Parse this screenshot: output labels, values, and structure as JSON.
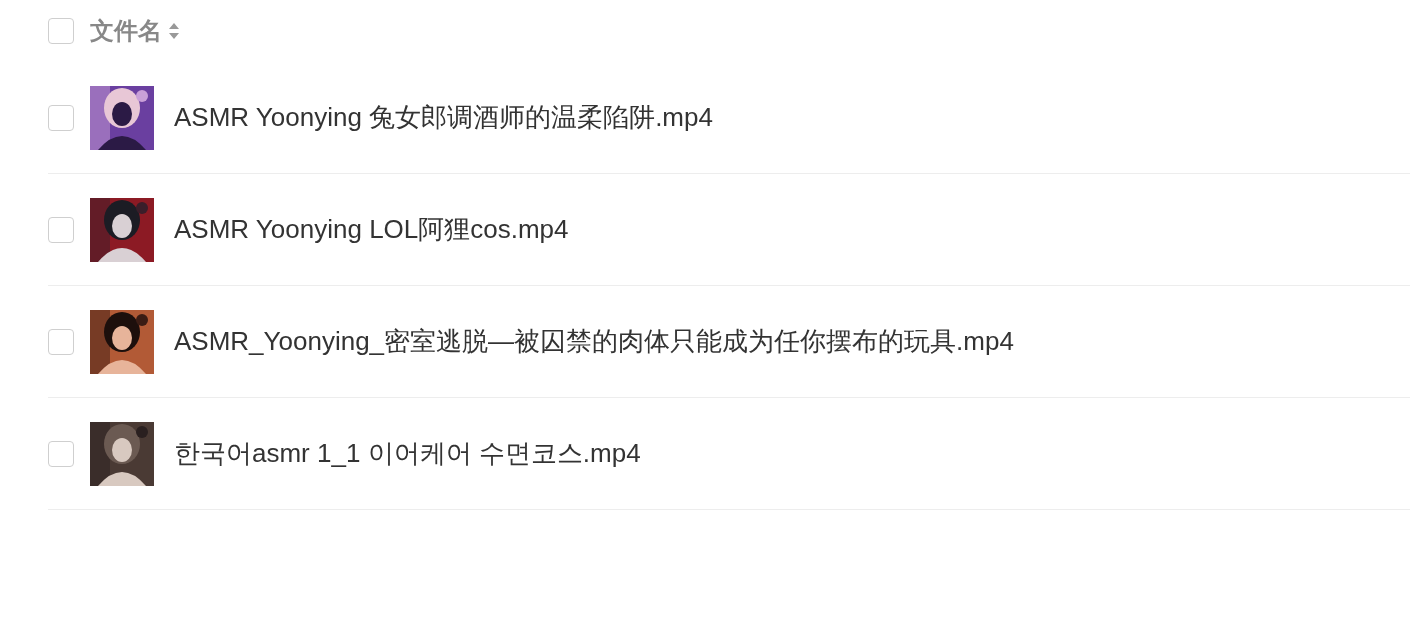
{
  "header": {
    "checked": false,
    "label": "文件名"
  },
  "files": [
    {
      "checked": false,
      "name": "ASMR Yoonying 兔女郎调酒师的温柔陷阱.mp4"
    },
    {
      "checked": false,
      "name": "ASMR Yoonying LOL阿狸cos.mp4"
    },
    {
      "checked": false,
      "name": "ASMR_Yoonying_密室逃脱—被囚禁的肉体只能成为任你摆布的玩具.mp4"
    },
    {
      "checked": false,
      "name": "한국어asmr 1_1 이어케어 수면코스.mp4"
    }
  ]
}
